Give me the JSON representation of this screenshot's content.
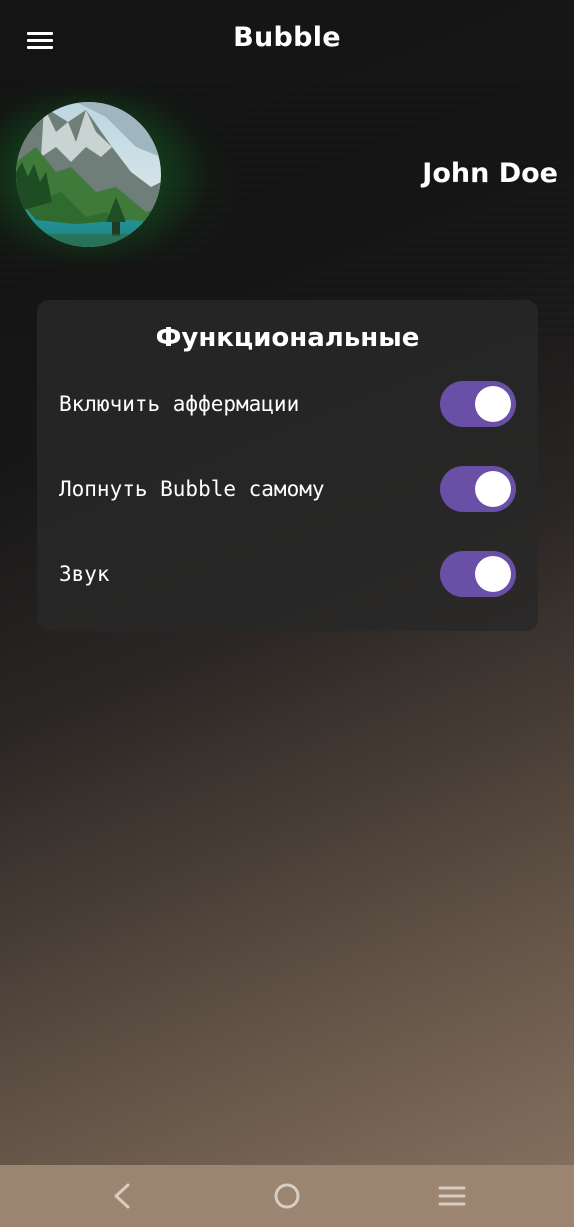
{
  "header": {
    "title": "Bubble",
    "menu_icon": "hamburger-menu-icon"
  },
  "profile": {
    "name": "John Doe",
    "avatar": "mountain-lake-avatar"
  },
  "settings_card": {
    "title": "Функциональные",
    "items": [
      {
        "label": "Включить аффермации",
        "enabled": true
      },
      {
        "label": "Лопнуть Bubble самому",
        "enabled": true
      },
      {
        "label": "Звук",
        "enabled": true
      }
    ]
  },
  "colors": {
    "toggle_on": "#6a4fa6",
    "knob": "#ffffff",
    "nav_bar": "#9b8470"
  },
  "system_nav": {
    "back_icon": "back-chevron-icon",
    "home_icon": "home-circle-icon",
    "recent_icon": "recent-apps-icon"
  }
}
